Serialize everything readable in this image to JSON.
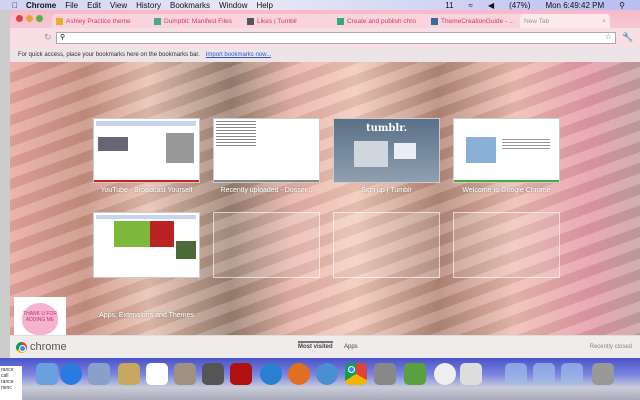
{
  "menubar": {
    "app": "Chrome",
    "items": [
      "File",
      "Edit",
      "View",
      "History",
      "Bookmarks",
      "Window",
      "Help"
    ],
    "status": {
      "calendar": "11",
      "battery": "(47%)",
      "clock": "Mon 6:49:42 PM"
    }
  },
  "tabs": [
    {
      "label": "Ashley Practice theme",
      "active": false
    },
    {
      "label": "Dumpbit: Manifest Files",
      "active": false
    },
    {
      "label": "Likes | Tumblr",
      "active": false
    },
    {
      "label": "Create and publish chro",
      "active": false
    },
    {
      "label": "ThemeCreationGuide - ...",
      "active": false
    },
    {
      "label": "New Tab",
      "active": true
    }
  ],
  "omnibox": {
    "value": "",
    "placeholder": ""
  },
  "bookmarks_bar": {
    "message": "For quick access, place your bookmarks here on the bookmarks bar.",
    "import_link": "Import bookmarks now..."
  },
  "most_visited": [
    {
      "title": "YouTube - Broadcast Yourself",
      "color": "#cc2222"
    },
    {
      "title": "Recently uploaded - Dosser...",
      "color": "#888888"
    },
    {
      "title": "Sign up | Tumblr",
      "color": "#34526f"
    },
    {
      "title": "Welcome to Google Chrome",
      "color": "#44aa44"
    },
    {
      "title": "Apps, Extensions and Themes",
      "color": "#4285f4"
    }
  ],
  "tumblr_logo": "tumblr.",
  "sticker_text": "THANK U FOR ADDING ME",
  "footer": {
    "brand": "chrome",
    "tabs": [
      "Most visited",
      "Apps"
    ],
    "recently_closed": "Recently closed"
  },
  "dock_side": [
    "rance call",
    "rance",
    "rienc"
  ]
}
